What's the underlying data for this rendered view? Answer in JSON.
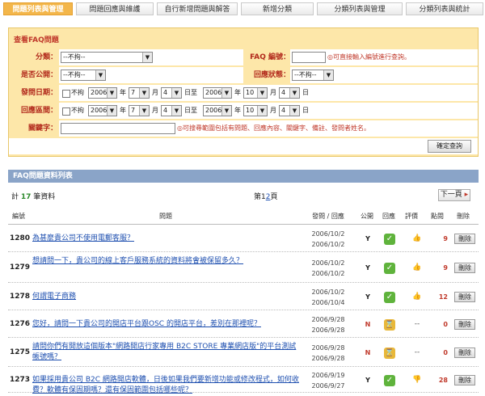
{
  "tabs": [
    "問題列表與管理",
    "問題回應與維護",
    "自行新增問題與解答",
    "新增分類",
    "分類列表與管理",
    "分類列表與統計"
  ],
  "search": {
    "title": "查看FAQ問題",
    "category_label": "分類：",
    "category_value": "--不拘--",
    "faq_no_label": "FAQ 編號：",
    "faq_no_hint": "◎可直接輸入編號進行查詢。",
    "public_label": "是否公開：",
    "public_value": "--不拘--",
    "reply_status_label": "回應狀態：",
    "reply_status_value": "--不拘--",
    "ask_date_label": "發問日期：",
    "reply_date_label": "回應區間：",
    "any_label": "不拘",
    "year_unit": "年",
    "month_unit": "月",
    "day_to": "日至",
    "day_unit": "日",
    "ask_from": {
      "y": "2006",
      "m": "7",
      "d": "4"
    },
    "ask_to": {
      "y": "2006",
      "m": "10",
      "d": "4"
    },
    "reply_from": {
      "y": "2006",
      "m": "7",
      "d": "4"
    },
    "reply_to": {
      "y": "2006",
      "m": "10",
      "d": "4"
    },
    "keyword_label": "關鍵字：",
    "keyword_hint": "◎可搜尋範圍包括有問題、回應內容、關鍵字、備註、發問者姓名。",
    "submit_label": "確定查詢"
  },
  "list": {
    "header": "FAQ問題資料列表",
    "total_prefix": "計",
    "total": "17",
    "total_suffix": "筆資料",
    "page_prefix": "第",
    "page_1": "1",
    "page_2": "2",
    "page_suffix": "頁",
    "next_label": "下一頁",
    "columns": [
      "編號",
      "問題",
      "發問 / 回應",
      "公開",
      "回應",
      "評價",
      "點閱",
      "刪除"
    ],
    "rows": [
      {
        "id": "1280",
        "title": "為甚麼貴公司不使用電郵客服？",
        "date1": "2006/10/2",
        "date2": "2006/10/2",
        "pub": "Y",
        "status": "ok",
        "rating": "👍",
        "clicks": "9",
        "del": "刪除"
      },
      {
        "id": "1279",
        "title": "想請問一下，貴公司的線上客戶服務系統的資料將會被保留多久？",
        "date1": "2006/10/2",
        "date2": "2006/10/2",
        "pub": "Y",
        "status": "ok",
        "rating": "👍",
        "clicks": "9",
        "del": "刪除"
      },
      {
        "id": "1278",
        "title": "何謂電子商務",
        "date1": "2006/10/2",
        "date2": "2006/10/4",
        "pub": "Y",
        "status": "ok",
        "rating": "👍",
        "clicks": "12",
        "del": "刪除"
      },
      {
        "id": "1276",
        "title": "您好，請問一下貴公司的開店平台跟OSC 的開店平台，差別在那裡呢？",
        "date1": "2006/9/28",
        "date2": "2006/9/28",
        "pub": "N",
        "status": "wait",
        "rating": "--",
        "clicks": "0",
        "del": "刪除"
      },
      {
        "id": "1275",
        "title": "請問你們有開放這個版本\"網路開店行家專用 B2C STORE 專業網店版\"的平台測試帳號嗎？",
        "date1": "2006/9/28",
        "date2": "2006/9/28",
        "pub": "N",
        "status": "wait",
        "rating": "--",
        "clicks": "0",
        "del": "刪除"
      },
      {
        "id": "1273",
        "title": "如果採用貴公司 B2C 網路開店軟體，日後如果我們要新增功能或修改程式，如何收費？軟體有保固期嗎？還有保固範圍包括哪些呢？",
        "date1": "2006/9/19",
        "date2": "2006/9/27",
        "pub": "Y",
        "status": "ok",
        "rating": "👎",
        "clicks": "28",
        "del": "刪除"
      }
    ]
  }
}
